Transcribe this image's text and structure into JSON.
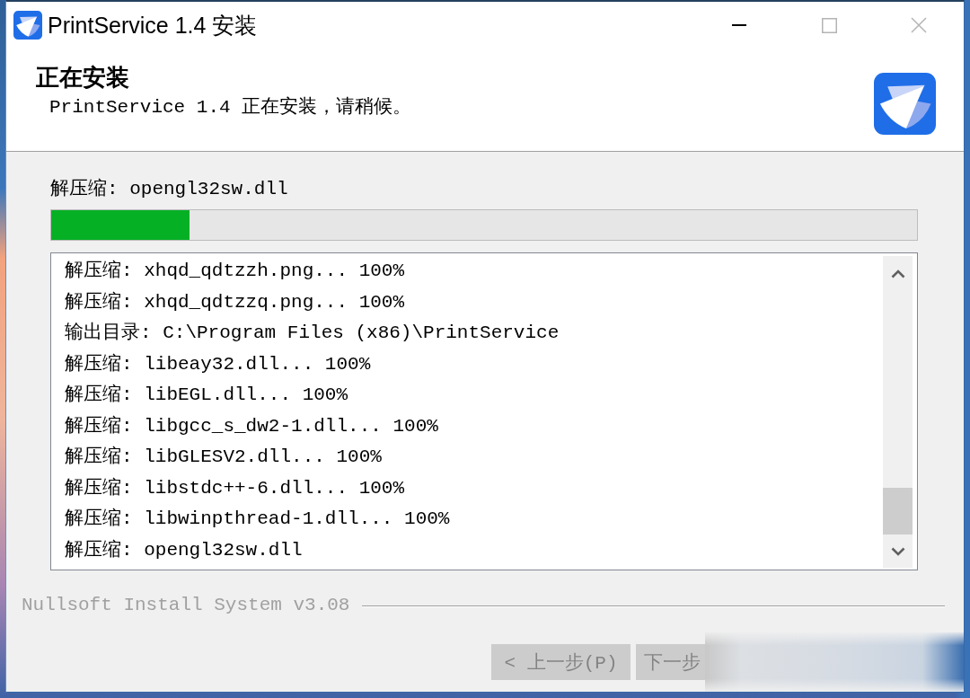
{
  "window": {
    "title": "PrintService 1.4 安装",
    "controls": [
      {
        "kind": "minimize",
        "disabled": false
      },
      {
        "kind": "maximize",
        "disabled": true
      },
      {
        "kind": "close",
        "disabled": true
      }
    ]
  },
  "header": {
    "title": "正在安装",
    "subtitle": "PrintService 1.4 正在安装，请稍候。"
  },
  "progress": {
    "status": "解压缩: opengl32sw.dll",
    "level": 0.16
  },
  "log": {
    "lines": [
      "解压缩: xhqd_qdtzzh.png... 100%",
      "解压缩: xhqd_qdtzzq.png... 100%",
      "输出目录: C:\\Program Files (x86)\\PrintService",
      "解压缩: libeay32.dll... 100%",
      "解压缩: libEGL.dll... 100%",
      "解压缩: libgcc_s_dw2-1.dll... 100%",
      "解压缩: libGLESV2.dll... 100%",
      "解压缩: libstdc++-6.dll... 100%",
      "解压缩: libwinpthread-1.dll... 100%",
      "解压缩: opengl32sw.dll"
    ]
  },
  "branding": "Nullsoft Install System v3.08",
  "buttons": [
    {
      "label": "< 上一步(P)",
      "disabled": true
    },
    {
      "label": "下一步",
      "disabled": true
    }
  ]
}
